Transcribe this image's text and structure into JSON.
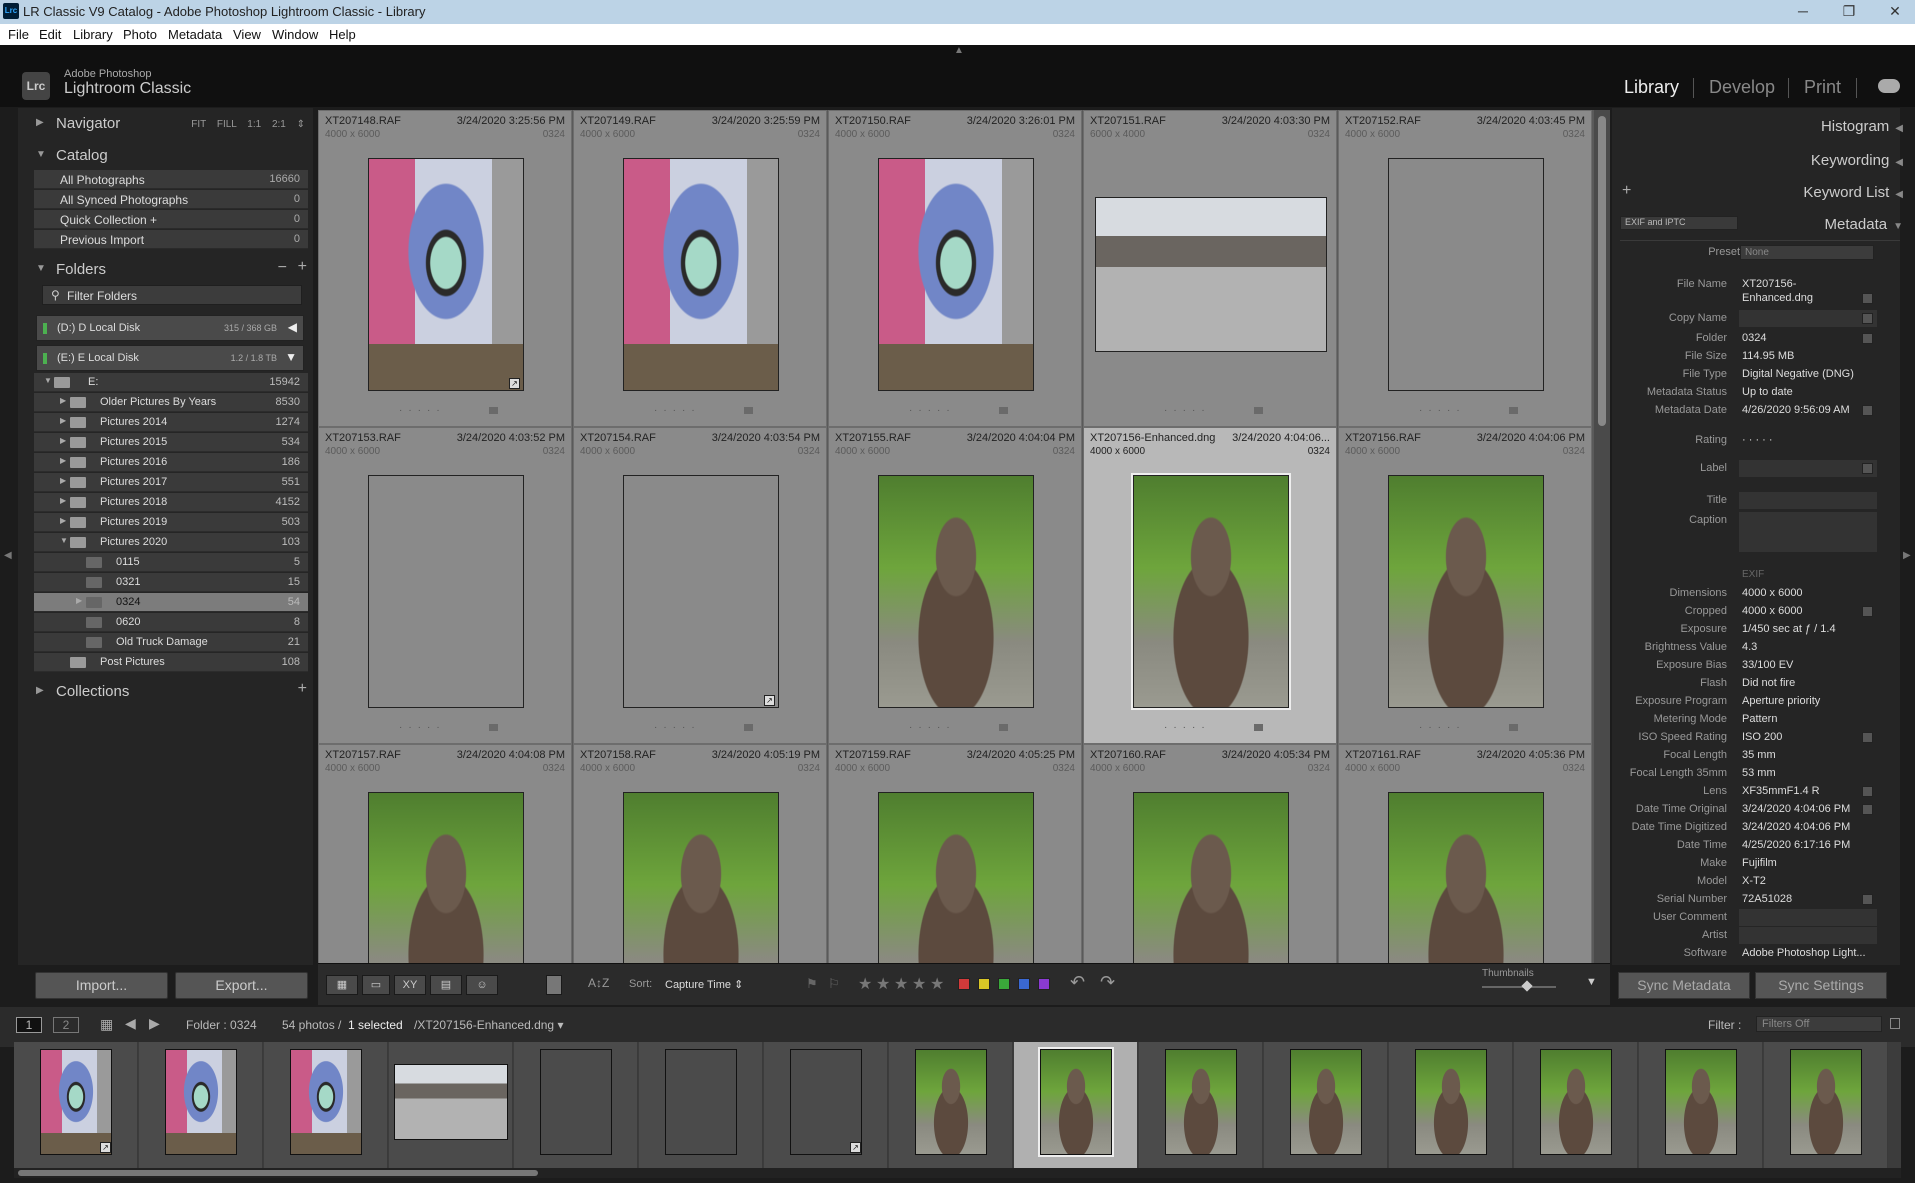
{
  "window": {
    "title": "LR Classic V9 Catalog - Adobe Photoshop Lightroom Classic - Library",
    "logo": "Lrc",
    "controls": [
      "─",
      "❐",
      "✕"
    ]
  },
  "menu": [
    "File",
    "Edit",
    "Library",
    "Photo",
    "Metadata",
    "View",
    "Window",
    "Help"
  ],
  "identity": {
    "line1": "Adobe Photoshop",
    "line2": "Lightroom Classic",
    "icon": "Lrc",
    "modules": [
      "Library",
      "Develop",
      "Print"
    ],
    "active": "Library"
  },
  "navigator": {
    "label": "Navigator",
    "options": "FIT FILL 1:1 2:1 ⇕"
  },
  "catalog": {
    "label": "Catalog",
    "items": [
      {
        "label": "All Photographs",
        "count": "16660"
      },
      {
        "label": "All Synced Photographs",
        "count": "0"
      },
      {
        "label": "Quick Collection +",
        "count": "0"
      },
      {
        "label": "Previous Import",
        "count": "0"
      }
    ]
  },
  "folders": {
    "label": "Folders",
    "filter": "Filter Folders",
    "disks": [
      {
        "label": "(D:) D Local Disk",
        "size": "315 / 368 GB",
        "arrow": "◀"
      },
      {
        "label": "(E:) E Local Disk",
        "size": "1.2 / 1.8 TB",
        "arrow": "▼"
      }
    ],
    "tree": [
      {
        "label": "E:",
        "count": "15942"
      },
      {
        "label": "Older Pictures By Years",
        "count": "8530"
      },
      {
        "label": "Pictures 2014",
        "count": "1274"
      },
      {
        "label": "Pictures 2015",
        "count": "534"
      },
      {
        "label": "Pictures 2016",
        "count": "186"
      },
      {
        "label": "Pictures 2017",
        "count": "551"
      },
      {
        "label": "Pictures 2018",
        "count": "4152"
      },
      {
        "label": "Pictures 2019",
        "count": "503"
      },
      {
        "label": "Pictures 2020",
        "count": "103"
      },
      {
        "label": "0115",
        "count": "5"
      },
      {
        "label": "0321",
        "count": "15"
      },
      {
        "label": "0324",
        "count": "54"
      },
      {
        "label": "0620",
        "count": "8"
      },
      {
        "label": "Old Truck Damage",
        "count": "21"
      },
      {
        "label": "Post Pictures",
        "count": "108"
      }
    ]
  },
  "collections": {
    "label": "Collections"
  },
  "left_buttons": {
    "import": "Import...",
    "export": "Export..."
  },
  "grid": [
    {
      "fn": "XT207148.RAF",
      "dt": "3/24/2020 3:25:56 PM",
      "dim": "4000 x 6000",
      "fo": "0324"
    },
    {
      "fn": "XT207149.RAF",
      "dt": "3/24/2020 3:25:59 PM",
      "dim": "4000 x 6000",
      "fo": "0324"
    },
    {
      "fn": "XT207150.RAF",
      "dt": "3/24/2020 3:26:01 PM",
      "dim": "4000 x 6000",
      "fo": "0324"
    },
    {
      "fn": "XT207151.RAF",
      "dt": "3/24/2020 4:03:30 PM",
      "dim": "6000 x 4000",
      "fo": "0324"
    },
    {
      "fn": "XT207152.RAF",
      "dt": "3/24/2020 4:03:45 PM",
      "dim": "4000 x 6000",
      "fo": "0324"
    },
    {
      "fn": "XT207153.RAF",
      "dt": "3/24/2020 4:03:52 PM",
      "dim": "4000 x 6000",
      "fo": "0324"
    },
    {
      "fn": "XT207154.RAF",
      "dt": "3/24/2020 4:03:54 PM",
      "dim": "4000 x 6000",
      "fo": "0324"
    },
    {
      "fn": "XT207155.RAF",
      "dt": "3/24/2020 4:04:04 PM",
      "dim": "4000 x 6000",
      "fo": "0324"
    },
    {
      "fn": "XT207156-Enhanced.dng",
      "dt": "3/24/2020 4:04:06...",
      "dim": "4000 x 6000",
      "fo": "0324"
    },
    {
      "fn": "XT207156.RAF",
      "dt": "3/24/2020 4:04:06 PM",
      "dim": "4000 x 6000",
      "fo": "0324"
    },
    {
      "fn": "XT207157.RAF",
      "dt": "3/24/2020 4:04:08 PM",
      "dim": "4000 x 6000",
      "fo": "0324"
    },
    {
      "fn": "XT207158.RAF",
      "dt": "3/24/2020 4:05:19 PM",
      "dim": "4000 x 6000",
      "fo": "0324"
    },
    {
      "fn": "XT207159.RAF",
      "dt": "3/24/2020 4:05:25 PM",
      "dim": "4000 x 6000",
      "fo": "0324"
    },
    {
      "fn": "XT207160.RAF",
      "dt": "3/24/2020 4:05:34 PM",
      "dim": "4000 x 6000",
      "fo": "0324"
    },
    {
      "fn": "XT207161.RAF",
      "dt": "3/24/2020 4:05:36 PM",
      "dim": "4000 x 6000",
      "fo": "0324"
    }
  ],
  "toolbar": {
    "sort_label": "Sort:",
    "sort_value": "Capture Time ⇕",
    "thumbnails": "Thumbnails",
    "az": "A↕Z"
  },
  "right": {
    "histogram": "Histogram",
    "keywording": "Keywording",
    "keyword_list": "Keyword List",
    "metadata": "Metadata",
    "metadata_set": "EXIF and IPTC",
    "preset_label": "Preset",
    "preset_value": "None",
    "rows": [
      {
        "k": "File Name",
        "v": "XT207156-"
      },
      {
        "k": "",
        "v": "Enhanced.dng"
      },
      {
        "k": "Copy Name",
        "v": ""
      },
      {
        "k": "Folder",
        "v": "0324"
      },
      {
        "k": "File Size",
        "v": "114.95 MB"
      },
      {
        "k": "File Type",
        "v": "Digital Negative (DNG)"
      },
      {
        "k": "Metadata Status",
        "v": "Up to date"
      },
      {
        "k": "Metadata Date",
        "v": "4/26/2020 9:56:09 AM"
      },
      {
        "k": "Rating",
        "v": "· · · · ·"
      },
      {
        "k": "Label",
        "v": ""
      },
      {
        "k": "Title",
        "v": ""
      },
      {
        "k": "Caption",
        "v": ""
      },
      {
        "k": "",
        "v": "EXIF"
      },
      {
        "k": "Dimensions",
        "v": "4000 x 6000"
      },
      {
        "k": "Cropped",
        "v": "4000 x 6000"
      },
      {
        "k": "Exposure",
        "v": "1/450 sec at ƒ / 1.4"
      },
      {
        "k": "Brightness Value",
        "v": "4.3"
      },
      {
        "k": "Exposure Bias",
        "v": "33/100 EV"
      },
      {
        "k": "Flash",
        "v": "Did not fire"
      },
      {
        "k": "Exposure Program",
        "v": "Aperture priority"
      },
      {
        "k": "Metering Mode",
        "v": "Pattern"
      },
      {
        "k": "ISO Speed Rating",
        "v": "ISO 200"
      },
      {
        "k": "Focal Length",
        "v": "35 mm"
      },
      {
        "k": "Focal Length 35mm",
        "v": "53 mm"
      },
      {
        "k": "Lens",
        "v": "XF35mmF1.4 R"
      },
      {
        "k": "Date Time Original",
        "v": "3/24/2020 4:04:06 PM"
      },
      {
        "k": "Date Time Digitized",
        "v": "3/24/2020 4:04:06 PM"
      },
      {
        "k": "Date Time",
        "v": "4/25/2020 6:17:16 PM"
      },
      {
        "k": "Make",
        "v": "Fujifilm"
      },
      {
        "k": "Model",
        "v": "X-T2"
      },
      {
        "k": "Serial Number",
        "v": "72A51028"
      },
      {
        "k": "User Comment",
        "v": ""
      },
      {
        "k": "Artist",
        "v": ""
      },
      {
        "k": "Software",
        "v": "Adobe Photoshop Light..."
      }
    ],
    "sync_metadata": "Sync Metadata",
    "sync_settings": "Sync Settings"
  },
  "filmbar": {
    "screen1": "1",
    "screen2": "2",
    "folder": "Folder : 0324",
    "count": "54 photos /",
    "selected": "1 selected",
    "file": "/XT207156-Enhanced.dng ▾",
    "filter_label": "Filter :",
    "filter_value": "Filters Off"
  }
}
